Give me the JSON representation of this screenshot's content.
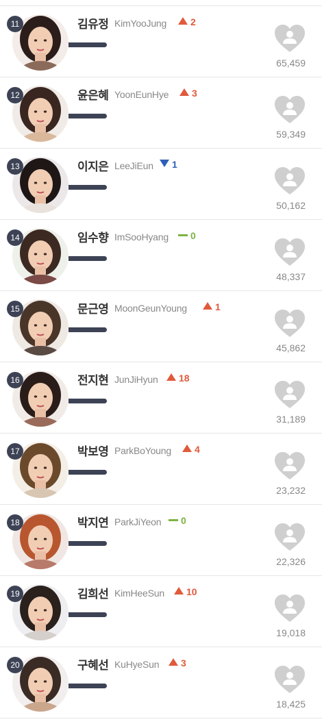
{
  "ranking": [
    {
      "rank": "11",
      "korean_name": "김유정",
      "english_name": "KimYooJung",
      "change_dir": "up",
      "change": "2",
      "votes": "65,459"
    },
    {
      "rank": "12",
      "korean_name": "윤은혜",
      "english_name": "YoonEunHye",
      "change_dir": "up",
      "change": "3",
      "votes": "59,349"
    },
    {
      "rank": "13",
      "korean_name": "이지은",
      "english_name": "LeeJiEun",
      "change_dir": "down",
      "change": "1",
      "votes": "50,162"
    },
    {
      "rank": "14",
      "korean_name": "임수향",
      "english_name": "ImSooHyang",
      "change_dir": "same",
      "change": "0",
      "votes": "48,337"
    },
    {
      "rank": "15",
      "korean_name": "문근영",
      "english_name": "MoonGeunYoung",
      "change_dir": "up",
      "change": "1",
      "votes": "45,862"
    },
    {
      "rank": "16",
      "korean_name": "전지현",
      "english_name": "JunJiHyun",
      "change_dir": "up",
      "change": "18",
      "votes": "31,189"
    },
    {
      "rank": "17",
      "korean_name": "박보영",
      "english_name": "ParkBoYoung",
      "change_dir": "up",
      "change": "4",
      "votes": "23,232"
    },
    {
      "rank": "18",
      "korean_name": "박지연",
      "english_name": "ParkJiYeon",
      "change_dir": "same",
      "change": "0",
      "votes": "22,326"
    },
    {
      "rank": "19",
      "korean_name": "김희선",
      "english_name": "KimHeeSun",
      "change_dir": "up",
      "change": "10",
      "votes": "19,018"
    },
    {
      "rank": "20",
      "korean_name": "구혜선",
      "english_name": "KuHyeSun",
      "change_dir": "up",
      "change": "3",
      "votes": "18,425"
    }
  ],
  "icons": {
    "vote": "heart-vote-icon",
    "up": "triangle-up-icon",
    "down": "triangle-down-icon",
    "same": "dash-icon"
  },
  "colors": {
    "badge": "#3d4355",
    "up": "#e05a3b",
    "down": "#2f5fb8",
    "same": "#7cb342",
    "heart": "#cfcfcf"
  }
}
